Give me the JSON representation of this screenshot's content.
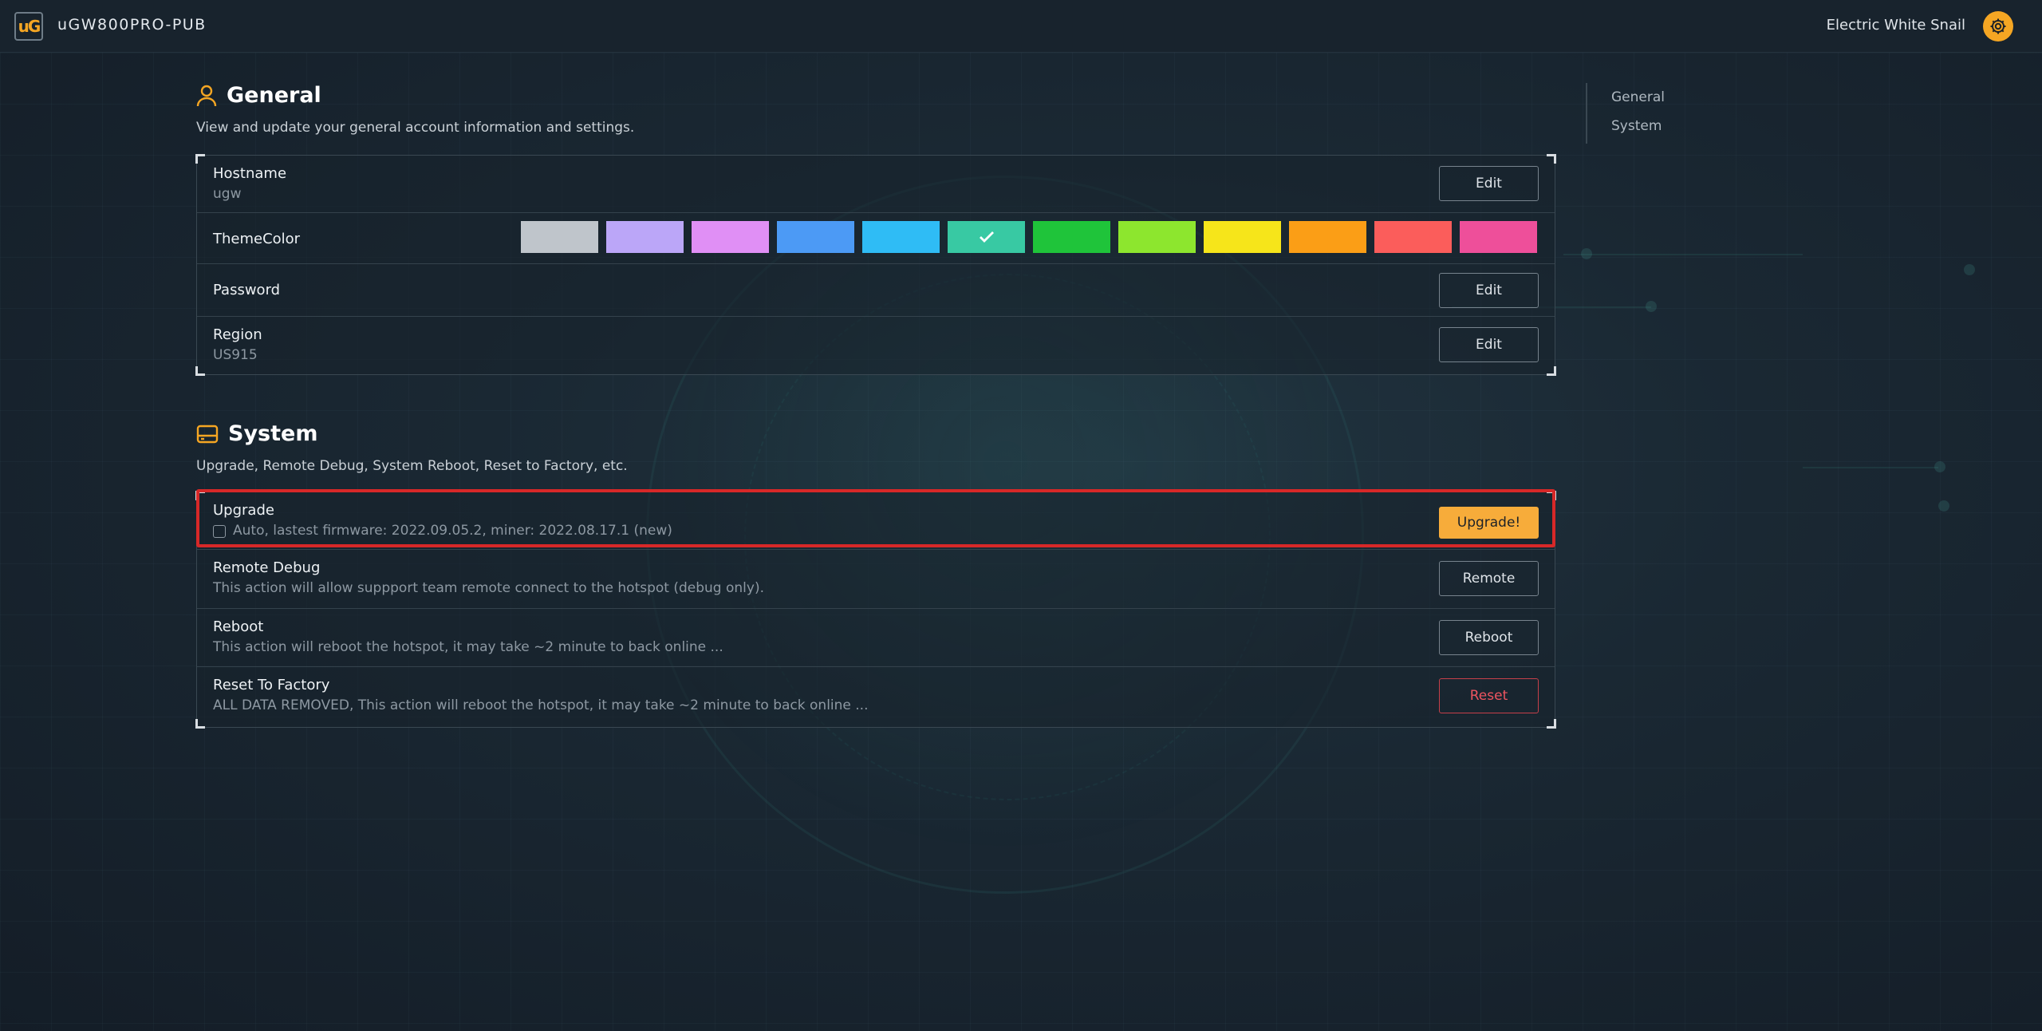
{
  "app": {
    "title": "uGW800PRO-PUB",
    "logo_text": "uG",
    "user_name": "Electric White Snail",
    "settings_icon": "gear-icon",
    "accent_color": "#f5a623"
  },
  "toc": {
    "items": [
      "General",
      "System"
    ]
  },
  "general": {
    "title": "General",
    "icon": "user-icon",
    "description": "View and update your general account information and settings.",
    "hostname": {
      "label": "Hostname",
      "value": "ugw",
      "button": "Edit"
    },
    "theme": {
      "label": "ThemeColor",
      "selected_index": 5,
      "colors": [
        "#bfc5cb",
        "#bba6f8",
        "#e08ff5",
        "#4c9af5",
        "#2fbcf5",
        "#38c9a3",
        "#1fc43a",
        "#8de62e",
        "#f6e51a",
        "#fb9e16",
        "#fb5d5b",
        "#ee4f9a"
      ]
    },
    "password": {
      "label": "Password",
      "button": "Edit"
    },
    "region": {
      "label": "Region",
      "value": "US915",
      "button": "Edit"
    }
  },
  "system": {
    "title": "System",
    "icon": "hard-drive-icon",
    "description": "Upgrade, Remote Debug, System Reboot, Reset to Factory, etc.",
    "upgrade": {
      "label": "Upgrade",
      "checkbox_checked": false,
      "info": "Auto, lastest firmware: 2022.09.05.2, miner: 2022.08.17.1 (new)",
      "button": "Upgrade!"
    },
    "remote_debug": {
      "label": "Remote Debug",
      "info": "This action will allow suppport team remote connect to the hotspot (debug only).",
      "button": "Remote"
    },
    "reboot": {
      "label": "Reboot",
      "info": "This action will reboot the hotspot, it may take ~2 minute to back online ...",
      "button": "Reboot"
    },
    "reset": {
      "label": "Reset To Factory",
      "info": "ALL DATA REMOVED, This action will reboot the hotspot, it may take ~2 minute to back online ...",
      "button": "Reset",
      "danger_color": "#ee5560"
    }
  }
}
